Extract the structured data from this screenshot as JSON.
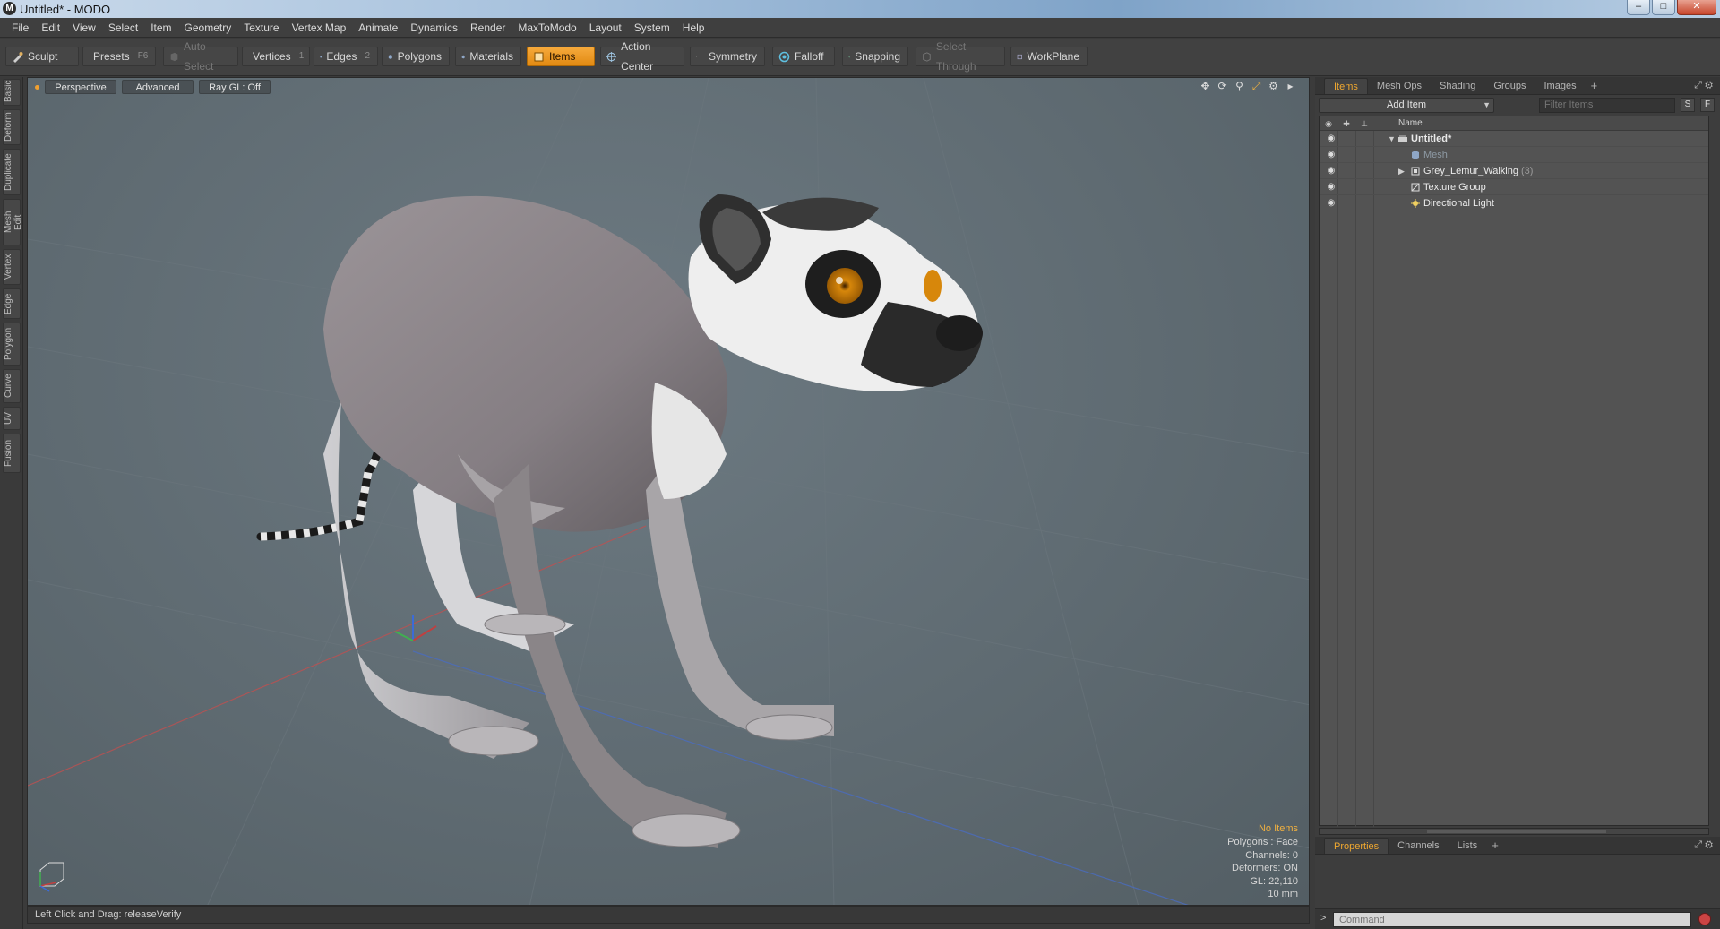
{
  "window": {
    "title": "Untitled* - MODO",
    "app_icon": "modo-logo-icon",
    "controls": [
      "minimize-icon",
      "maximize-icon",
      "close-icon"
    ]
  },
  "menubar": {
    "items": [
      "File",
      "Edit",
      "View",
      "Select",
      "Item",
      "Geometry",
      "Texture",
      "Vertex Map",
      "Animate",
      "Dynamics",
      "Render",
      "MaxToModo",
      "Layout",
      "System",
      "Help"
    ]
  },
  "toolbar": {
    "sculpt": "Sculpt",
    "presets": "Presets",
    "presets_key": "F6",
    "auto_select": "Auto Select",
    "vertices": "Vertices",
    "vertices_key": "1",
    "edges": "Edges",
    "edges_key": "2",
    "polygons": "Polygons",
    "materials": "Materials",
    "items": "Items",
    "action_center": "Action Center",
    "symmetry": "Symmetry",
    "falloff": "Falloff",
    "snapping": "Snapping",
    "select_through": "Select Through",
    "workplane": "WorkPlane",
    "active_color": "#f0a030"
  },
  "left_tabs": [
    "Basic",
    "Deform",
    "Duplicate",
    "Mesh Edit",
    "Vertex",
    "Edge",
    "Polygon",
    "Curve",
    "UV",
    "Fusion"
  ],
  "viewport": {
    "view_mode": "Perspective",
    "shading": "Advanced",
    "raygl": "Ray GL: Off",
    "info": {
      "selection": "No Items",
      "polygons": "Polygons : Face",
      "channels": "Channels: 0",
      "deformers": "Deformers: ON",
      "gl": "GL: 22,110",
      "scale": "10 mm"
    }
  },
  "statusbar": {
    "text": "Left Click and Drag:  releaseVerify"
  },
  "right_panel": {
    "top_tabs": [
      "Items",
      "Mesh Ops",
      "Shading",
      "Groups",
      "Images"
    ],
    "add_item": "Add Item",
    "filter_placeholder": "Filter Items",
    "btn_s": "S",
    "btn_f": "F",
    "column_name": "Name",
    "tree": [
      {
        "label": "Untitled*",
        "level": 0
      },
      {
        "label": "Mesh",
        "level": 1
      },
      {
        "label": "Grey_Lemur_Walking",
        "count": "(3)",
        "level": 1
      },
      {
        "label": "Texture Group",
        "level": 1
      },
      {
        "label": "Directional Light",
        "level": 1
      }
    ],
    "bottom_tabs": [
      "Properties",
      "Channels",
      "Lists"
    ],
    "command_placeholder": "Command"
  }
}
